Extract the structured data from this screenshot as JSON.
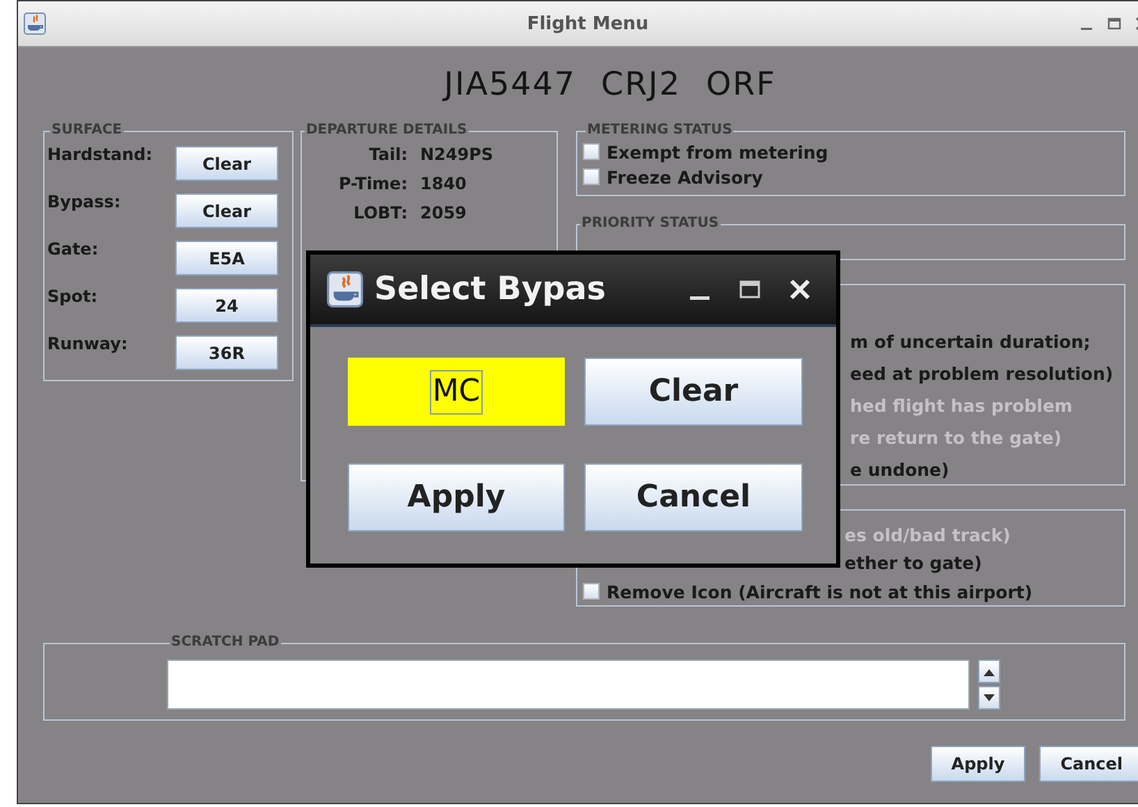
{
  "window": {
    "title": "Flight Menu"
  },
  "header": {
    "callsign": "JIA5447",
    "aircraft": "CRJ2",
    "destination": "ORF"
  },
  "surface": {
    "title": "SURFACE",
    "rows": [
      {
        "label": "Hardstand:",
        "value": "Clear"
      },
      {
        "label": "Bypass:",
        "value": "Clear"
      },
      {
        "label": "Gate:",
        "value": "E5A"
      },
      {
        "label": "Spot:",
        "value": "24"
      },
      {
        "label": "Runway:",
        "value": "36R"
      }
    ]
  },
  "departure_details": {
    "title": "DEPARTURE DETAILS",
    "rows": [
      {
        "label": "Tail:",
        "value": "N249PS"
      },
      {
        "label": "P-Time:",
        "value": "1840"
      },
      {
        "label": "LOBT:",
        "value": "2059"
      }
    ]
  },
  "metering_status": {
    "title": "METERING STATUS",
    "options": [
      {
        "label": "Exempt from metering",
        "checked": false
      },
      {
        "label": "Freeze Advisory",
        "checked": false
      }
    ]
  },
  "priority_status": {
    "title": "PRIORITY STATUS"
  },
  "panel_3": {
    "lines": [
      {
        "text": "m of uncertain duration;",
        "disabled": false
      },
      {
        "text": "eed at problem resolution)",
        "disabled": false
      },
      {
        "text": "hed flight has problem",
        "disabled": true
      },
      {
        "text": "re return to the gate)",
        "disabled": true
      },
      {
        "text": "e undone)",
        "disabled": false
      }
    ]
  },
  "panel_4": {
    "lines": [
      {
        "kind": "fragment",
        "text": "es old/bad track)",
        "disabled": true
      },
      {
        "kind": "fragment",
        "text": "ether to gate)",
        "disabled": false
      },
      {
        "kind": "checkbox",
        "text": "Remove Icon (Aircraft is not at this airport)",
        "disabled": false,
        "checked": false
      }
    ]
  },
  "scratch_pad": {
    "title": "SCRATCH PAD"
  },
  "buttons": [
    "Apply",
    "Cancel"
  ],
  "dialog": {
    "title": "Select Bypas",
    "value": "MC",
    "buttons": [
      "Clear",
      "Apply",
      "Cancel"
    ]
  }
}
